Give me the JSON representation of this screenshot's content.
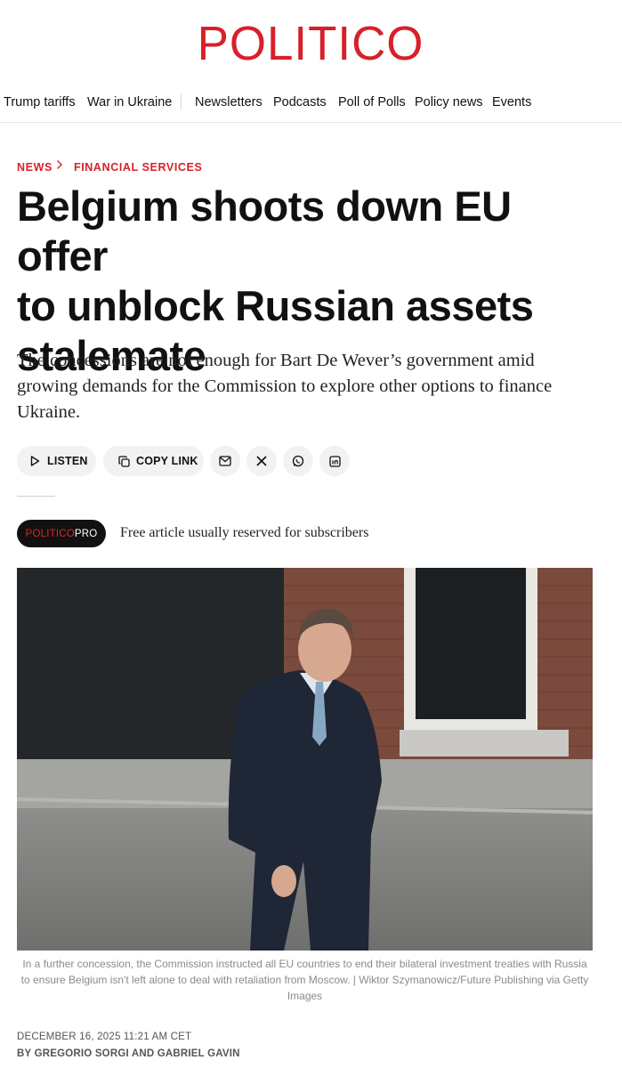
{
  "brand": {
    "logo_text": "POLITICO",
    "accent": "#d8202a"
  },
  "nav": {
    "items": [
      "Trump tariffs",
      "War in Ukraine",
      "Newsletters",
      "Podcasts",
      "Poll of Polls",
      "Policy news",
      "Events"
    ]
  },
  "breadcrumb": {
    "section": "NEWS",
    "subsection": "FINANCIAL SERVICES"
  },
  "article": {
    "headline_lines": [
      "Belgium shoots down EU offer",
      "to unblock Russian assets",
      "stalemate"
    ],
    "dek": "The concessions are not enough for Bart De Wever’s government amid growing demands for the Commission to explore other options to finance Ukraine.",
    "actions": {
      "listen": "LISTEN",
      "copy_link": "COPY LINK"
    },
    "share_icons": [
      "mail-icon",
      "x-icon",
      "whatsapp-icon",
      "linkedin-icon"
    ],
    "pro_badge": {
      "part1": "POLITICO",
      "part2": "PRO"
    },
    "free_note": "Free article usually reserved for subscribers",
    "caption": "In a further concession, the Commission instructed all EU countries to end their bilateral investment treaties with Russia to ensure Belgium isn't left alone to deal with retaliation from Moscow. | Wiktor Szymanowicz/Future Publishing via Getty Images",
    "dateline": "DECEMBER 16, 2025 11:21 AM CET",
    "byline": "BY GREGORIO SORGI AND GABRIEL GAVIN"
  }
}
